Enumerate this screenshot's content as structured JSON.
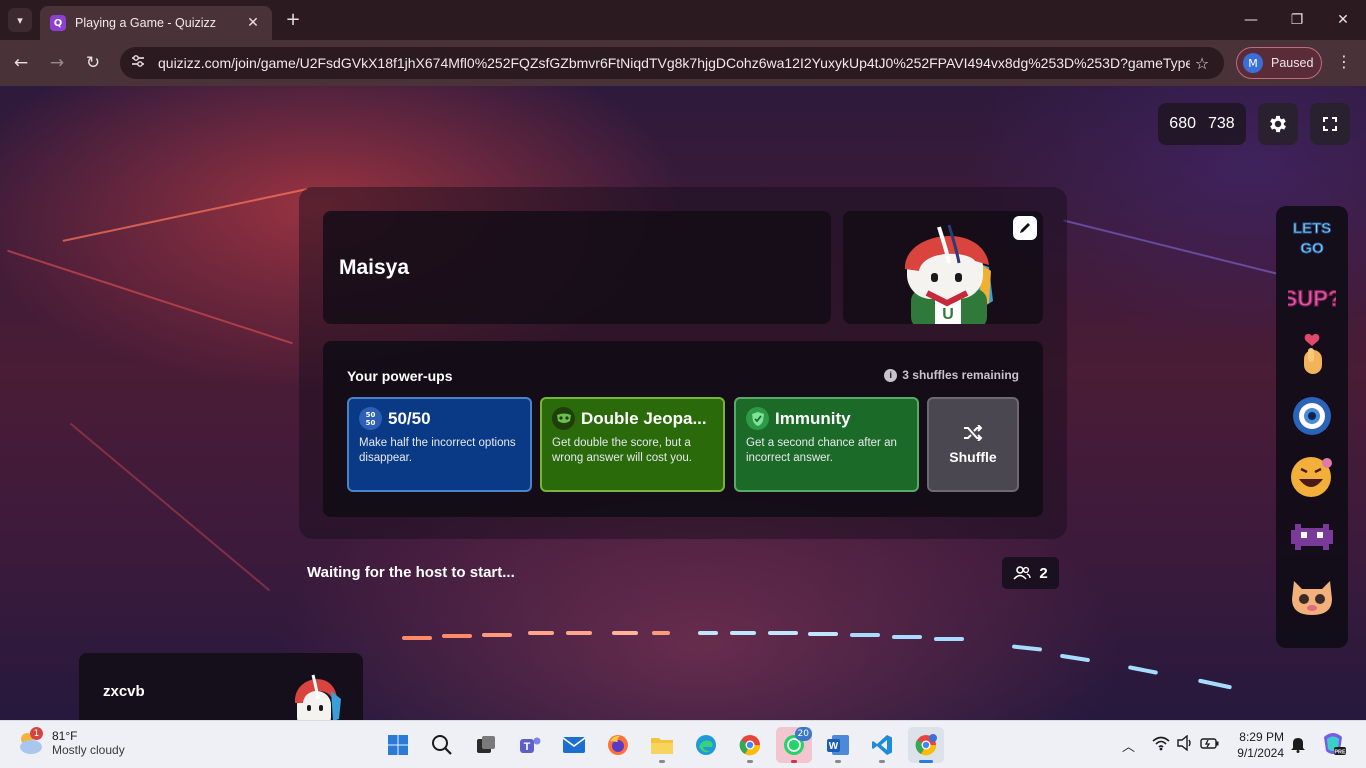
{
  "browser": {
    "tab_title": "Playing a Game - Quizizz",
    "favicon_text": "Q",
    "url": "quizizz.com/join/game/U2FsdGVkX18f1jhX674Mfl0%252FQZsfGZbmvr6FtNiqdTVg8k7hjgDCohz6wa12I2YuxykUp4tJ0%252FPAVI494vx8dg%253D%253D?gameType=...",
    "profile_initial": "M",
    "profile_label": "Paused"
  },
  "game": {
    "score_left": "680",
    "score_right": "738",
    "player_name": "Maisya",
    "powerups_heading": "Your power-ups",
    "shuffles_remaining": "3 shuffles remaining",
    "powerups": [
      {
        "title": "50/50",
        "icon_text": "50 50",
        "description": "Make half the incorrect options disappear.",
        "color": "#0a3a86",
        "border": "#4a82c9"
      },
      {
        "title": "Double Jeopa...",
        "icon_text": "",
        "description": "Get double the score, but a wrong answer will cost you.",
        "color": "#2a6a0a",
        "border": "#7ab33c"
      },
      {
        "title": "Immunity",
        "icon_text": "",
        "description": "Get a second chance after an incorrect answer.",
        "color": "#1c6a28",
        "border": "#5aa96a"
      }
    ],
    "shuffle_label": "Shuffle",
    "waiting_text": "Waiting for the host to start...",
    "players_count": "2",
    "other_player_name": "zxcvb",
    "reactions": [
      "lets-go-sticker",
      "sup-sticker",
      "heart-hand-sticker",
      "eye-sticker",
      "laughing-face-sticker",
      "pixel-monster-sticker",
      "cat-face-sticker"
    ]
  },
  "taskbar": {
    "weather_temp": "81°F",
    "weather_desc": "Mostly cloudy",
    "weather_badge": "1",
    "whatsapp_badge": "20",
    "time": "8:29 PM",
    "date": "9/1/2024"
  },
  "colors": {
    "chrome_bg": "#4a3338",
    "accent_purple": "#8d3fd1",
    "taskbar_bg": "#eef0f6"
  }
}
